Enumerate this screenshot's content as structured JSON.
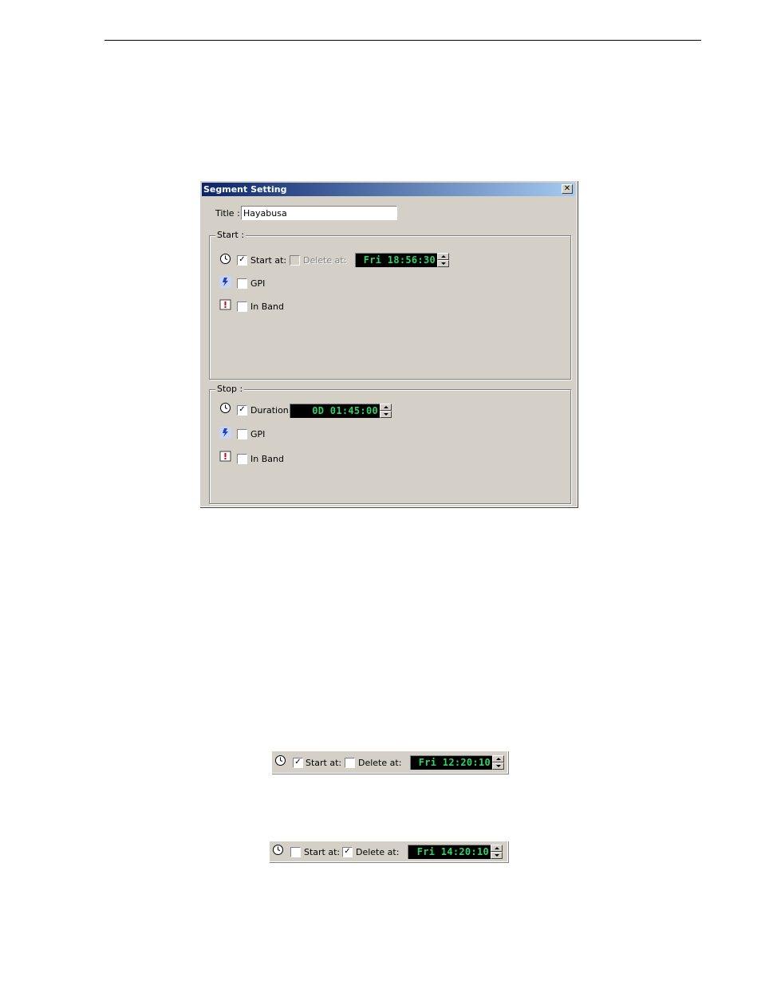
{
  "dialog": {
    "title": "Segment Setting",
    "close_glyph": "✕",
    "title_label": "Title :",
    "title_value": "Hayabusa",
    "start": {
      "legend": "Start :",
      "start_at_label": "Start at:",
      "start_at_checked": true,
      "delete_at_label": "Delete at:",
      "delete_at_checked": false,
      "delete_at_enabled": false,
      "time": "Fri 18:56:30",
      "gpi_label": "GPI",
      "gpi_checked": false,
      "inband_label": "In Band",
      "inband_checked": false
    },
    "stop": {
      "legend": "Stop :",
      "duration_label": "Duration :",
      "duration_checked": true,
      "time": "0D 01:45:00",
      "gpi_label": "GPI",
      "gpi_checked": false,
      "inband_label": "In Band",
      "inband_checked": false
    }
  },
  "strip1": {
    "start_at_label": "Start at:",
    "start_at_checked": true,
    "delete_at_label": "Delete at:",
    "delete_at_checked": false,
    "time": "Fri 12:20:10"
  },
  "strip2": {
    "start_at_label": "Start at:",
    "start_at_checked": false,
    "delete_at_label": "Delete at:",
    "delete_at_checked": true,
    "time": "Fri 14:20:10"
  },
  "icons": [
    "clock-icon",
    "gpi-icon",
    "inband-icon"
  ],
  "colors": {
    "titlebar_start": "#0a246a",
    "titlebar_end": "#a6caf0",
    "time_text": "#2fd36a",
    "dialog_bg": "#d4d0c8"
  }
}
